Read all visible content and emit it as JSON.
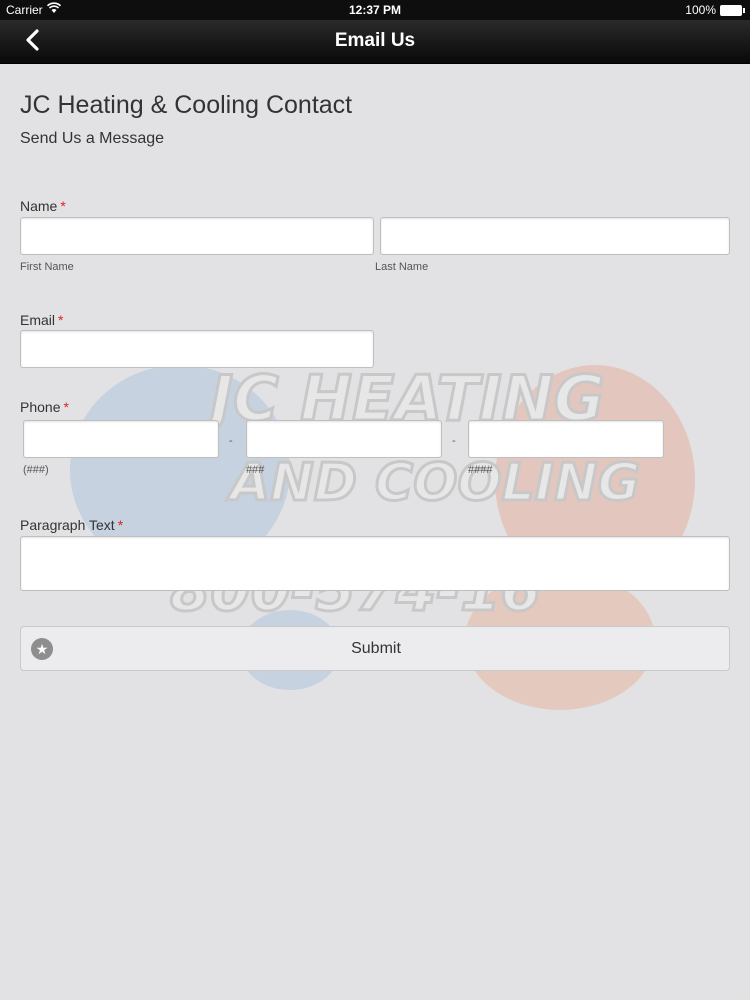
{
  "status_bar": {
    "carrier": "Carrier",
    "time": "12:37 PM",
    "battery": "100%"
  },
  "nav": {
    "title": "Email Us"
  },
  "form": {
    "heading": "JC Heating & Cooling Contact",
    "subheading": "Send Us a Message",
    "name": {
      "label": "Name",
      "required": "*",
      "first_sub": "First Name",
      "last_sub": "Last Name"
    },
    "email": {
      "label": "Email",
      "required": "*"
    },
    "phone": {
      "label": "Phone",
      "required": "*",
      "sub1": "(###)",
      "sub2": "###",
      "sub3": "####",
      "sep": "-"
    },
    "paragraph": {
      "label": "Paragraph Text",
      "required": "*"
    },
    "submit_label": "Submit"
  },
  "watermark": {
    "line1": "JC HEATING",
    "line2": "AND COOLING",
    "line3": "800-574-16"
  },
  "icons": {
    "back": "chevron-left-icon",
    "wifi": "wifi-icon",
    "battery": "battery-icon",
    "submit": "star-icon"
  }
}
